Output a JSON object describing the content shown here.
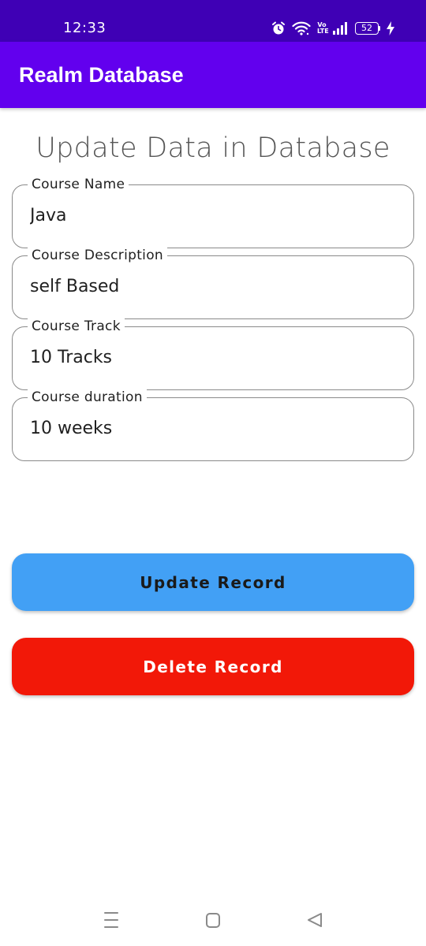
{
  "status_bar": {
    "time": "12:33",
    "volte_line1": "Vo",
    "volte_line2": "LTE",
    "battery": "52"
  },
  "app_bar": {
    "title": "Realm Database"
  },
  "page": {
    "heading": "Update Data in Database"
  },
  "fields": [
    {
      "label": "Course Name",
      "value": "Java"
    },
    {
      "label": "Course Description",
      "value": "self Based"
    },
    {
      "label": "Course Track",
      "value": "10 Tracks"
    },
    {
      "label": "Course duration",
      "value": "10 weeks"
    }
  ],
  "buttons": {
    "update_label": "Update Record",
    "delete_label": "Delete Record"
  },
  "colors": {
    "status_bar": "#3f00b5",
    "app_bar": "#6200ee",
    "update_button": "#42a0f5",
    "delete_button": "#f21808"
  },
  "icons": {
    "status": [
      "alarm-icon",
      "wifi-icon",
      "volte-icon",
      "signal-icon",
      "battery-icon",
      "charging-icon"
    ],
    "nav": [
      "recents-icon",
      "home-icon",
      "back-icon"
    ]
  }
}
